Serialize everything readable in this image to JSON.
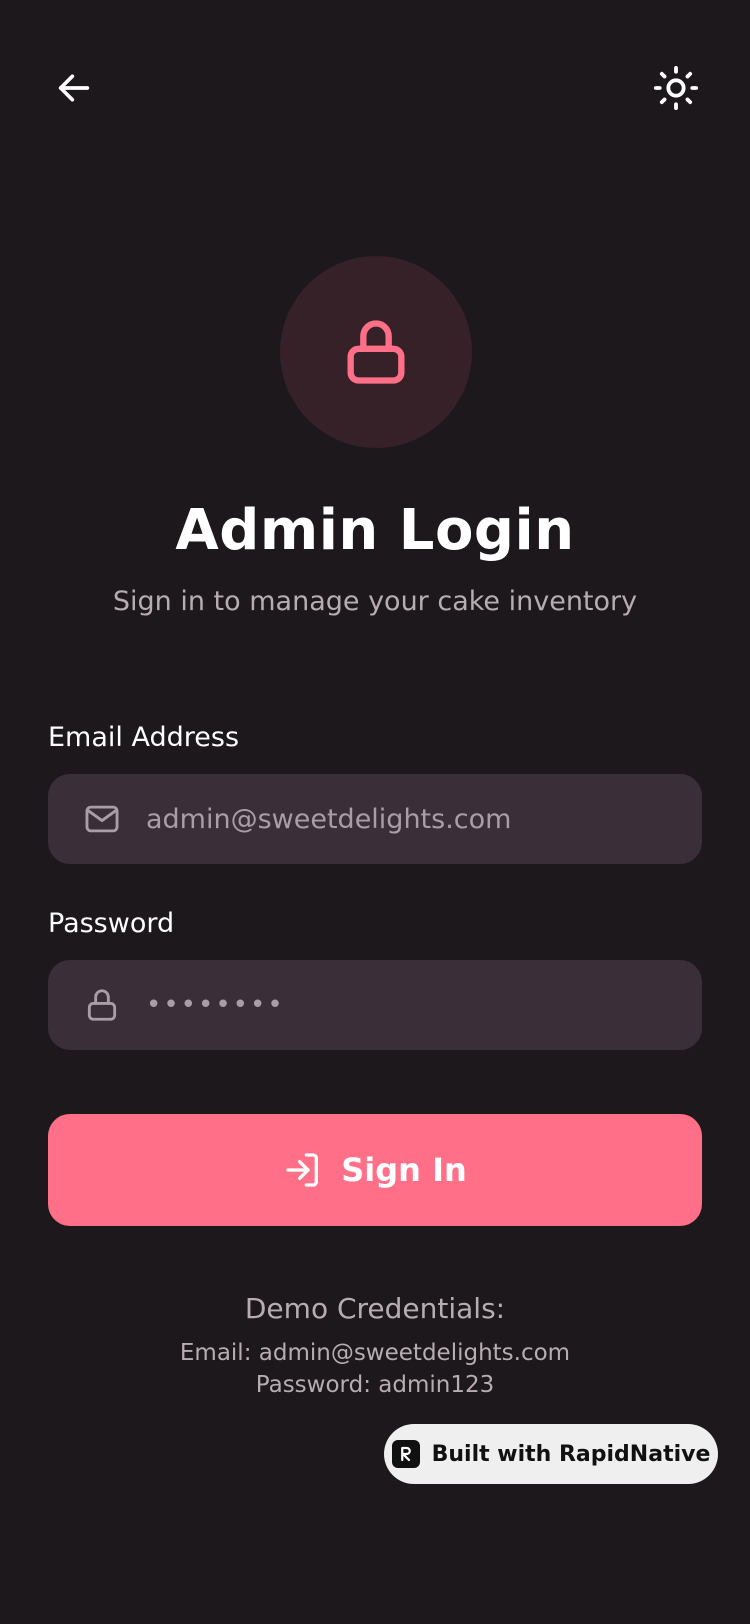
{
  "header": {
    "back_icon": "arrow-left-icon",
    "theme_icon": "sun-icon"
  },
  "hero": {
    "icon": "lock-icon",
    "title": "Admin Login",
    "subtitle": "Sign in to manage your cake inventory"
  },
  "form": {
    "email": {
      "label": "Email Address",
      "placeholder": "admin@sweetdelights.com",
      "icon": "mail-icon"
    },
    "password": {
      "label": "Password",
      "masked_value": "••••••••",
      "icon": "lock-icon"
    },
    "submit_label": "Sign In",
    "submit_icon": "log-in-icon"
  },
  "demo": {
    "title": "Demo Credentials:",
    "email_line": "Email: admin@sweetdelights.com",
    "password_line": "Password: admin123"
  },
  "badge": {
    "label": "Built with RapidNative"
  },
  "colors": {
    "background": "#1c181c",
    "accent": "#ff7088",
    "field": "#3a2f39",
    "muted_text": "#b8acb3"
  }
}
